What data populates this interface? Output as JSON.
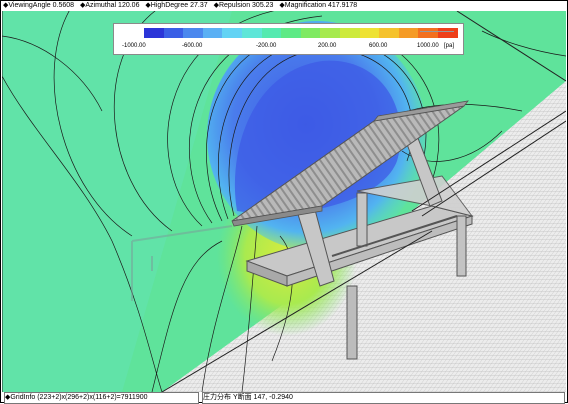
{
  "topbar": {
    "items": [
      "◆ViewingAngle  0.5608",
      "◆Azimuthal 120.06",
      "◆HighDegree 27.37",
      "◆Repulsion 305.23",
      "◆Magnification 417.9178"
    ]
  },
  "legend": {
    "tick_labels": [
      "-1000.00",
      "-600.00",
      "-200.00",
      "200.00",
      "600.00",
      "1000.00"
    ],
    "unit": "[pa]",
    "colors": [
      "#2b35d8",
      "#3a5fe6",
      "#4b88ee",
      "#5bb0f4",
      "#63d3f4",
      "#5fe6d8",
      "#55eab0",
      "#5eea86",
      "#7fea62",
      "#a6ea4e",
      "#cdea3c",
      "#eee233",
      "#f5c22c",
      "#f59b26",
      "#f3701f",
      "#ee3f1a"
    ]
  },
  "bottombar": {
    "grid_info": "◆GridInfo   (223+2)x(296+2)x(116+2)=7911900",
    "section_info": "圧力分布 Y断面  147,   -0.2940"
  },
  "scene": {
    "field_colors": {
      "background_grid": "#e6e6e6",
      "green": "#5ce39a",
      "blue": "#3f64ea"
    }
  }
}
